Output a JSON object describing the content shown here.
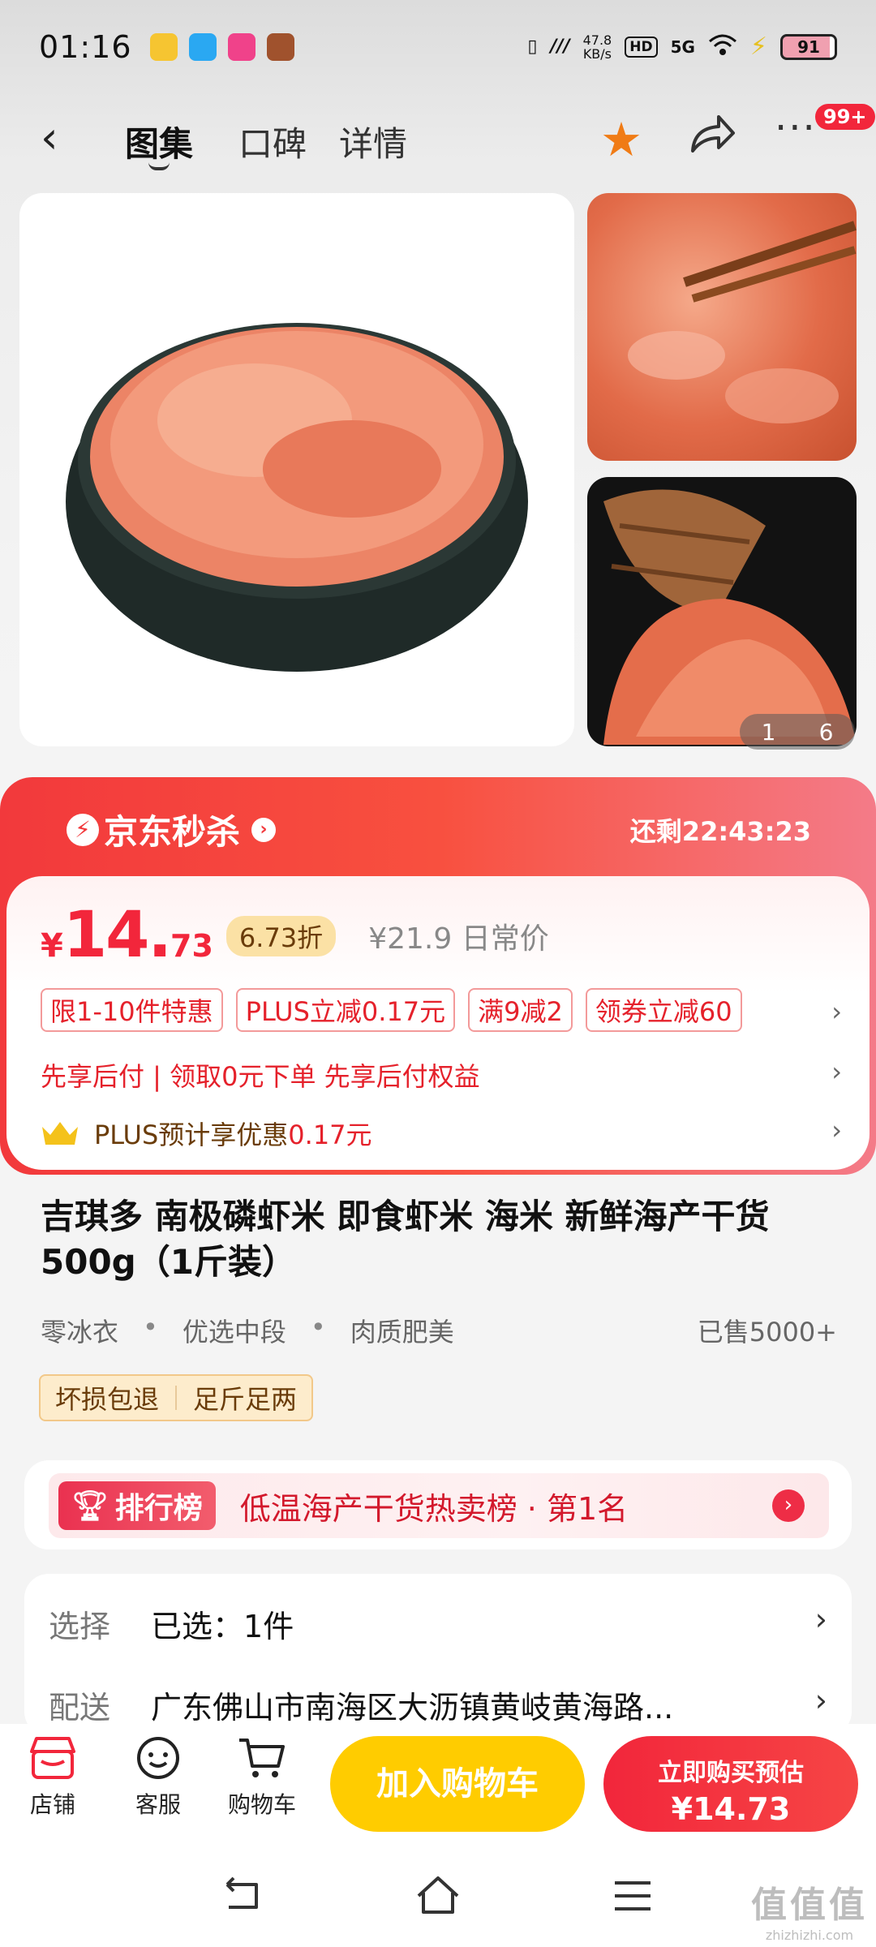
{
  "status_bar": {
    "time": "01:16",
    "net_speed_value": "47.8",
    "net_speed_unit": "KB/s",
    "hd": "HD",
    "network": "5G",
    "battery": "91"
  },
  "nav": {
    "tabs": [
      "图集",
      "口碑",
      "详情"
    ],
    "active_tab": "图集",
    "badge": "99+"
  },
  "gallery": {
    "counter_current": "1",
    "counter_total": "6"
  },
  "seckill": {
    "brand": "京东秒杀",
    "countdown": "还剩22:43:23"
  },
  "price": {
    "currency": "¥",
    "integer": "14.",
    "decimal": "73",
    "discount": "6.73折",
    "original": "¥21.9 日常价"
  },
  "tags": [
    "限1-10件特惠",
    "PLUS立减0.17元",
    "满9减2",
    "领券立减60"
  ],
  "pay_later": "先享后付 | 领取0元下单 先享后付权益",
  "plus": {
    "text": "PLUS预计享优惠",
    "amount": "0.17元"
  },
  "product": {
    "title": "吉琪多 南极磷虾米 即食虾米 海米 新鲜海产干货 500g（1斤装）",
    "features": [
      "零冰衣",
      "优选中段",
      "肉质肥美"
    ],
    "sold": "已售5000+",
    "promises": [
      "坏损包退",
      "足斤足两"
    ]
  },
  "rank": {
    "badge": "排行榜",
    "text": "低温海产干货热卖榜 · 第1名"
  },
  "select": {
    "row1_key": "选择",
    "row1_value": "已选：1件",
    "row2_key": "配送",
    "row2_value": "广东佛山市南海区大沥镇黄岐黄海路..."
  },
  "bottom_bar": {
    "shop": "店铺",
    "service": "客服",
    "cart": "购物车",
    "add_to_cart": "加入购物车",
    "buy_now": "立即购买预估",
    "buy_price": "¥14.73"
  },
  "watermark": {
    "line1": "值值值",
    "line2": "zhizhizhi.com"
  },
  "colors": {
    "accent_red": "#f2263b",
    "cart_yellow": "#ffcc00",
    "star_orange": "#f07b15"
  }
}
